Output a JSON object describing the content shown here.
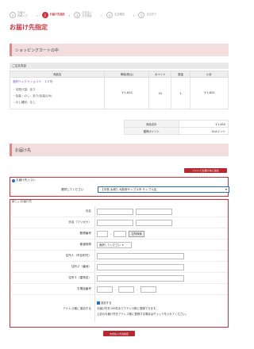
{
  "steps": [
    {
      "num": "1",
      "label": "お届け\n情報入力"
    },
    {
      "num": "2",
      "label": "お届け先指定"
    },
    {
      "num": "3",
      "label": "お支払い\n方法指定"
    },
    {
      "num": "4",
      "label": "注文確認"
    },
    {
      "num": "5",
      "label": "注文完了"
    }
  ],
  "page_title": "お届け先指定",
  "cart_section_title": "ショッピングカートの中",
  "order_details_label": "ご注文内容",
  "cart_headers": [
    "商品名",
    "単価(税込)",
    "ポイント",
    "数量",
    "小計"
  ],
  "cart_item": {
    "name": "酒好ベイクドショコラ　１２号",
    "options": [
      "・手提げ袋：あり",
      "・包装・のし：あり(包装のみ)",
      "・のし種別：なし"
    ],
    "price": "￥1,620",
    "points": "15",
    "qty": "1",
    "subtotal": "￥1,620"
  },
  "totals": [
    {
      "label": "商品合計",
      "value": "￥1,620"
    },
    {
      "label": "獲得ポイント",
      "value": "15ポイント"
    }
  ],
  "address_section_title": "お届け先",
  "add_to_list_button": "いいいでお届け先に追加",
  "address_list": {
    "header": "お届け先リスト",
    "prompt": "選択してください",
    "selected": "【中島 太郎】大阪府サンプル市 サンプル区"
  },
  "new_address_header": "新しいお届け先",
  "form": {
    "name_label": "氏名",
    "kana_label": "氏名（フリガナ）",
    "zip_label": "郵便番号",
    "zip_dash": "-",
    "zip_search_button": "住所検索",
    "pref_label": "都道府県",
    "pref_placeholder": "選択してください",
    "addr1_label": "住所１（市区町村）",
    "addr2_label": "住所２（番地）",
    "addr3_label": "住所３（建物名）",
    "phone_label": "お電話番号",
    "phone_dash": "-",
    "save_label": "アドレス帳に追加する",
    "save_checkbox": "追加する",
    "save_note1": "お届け先を150件までアドレス帳に登録できます。",
    "save_note2": "上記のお届け先をアドレス帳に登録する場合はチェックを入れてください。"
  },
  "submit_button": "お支払い方法指定",
  "colors": {
    "accent": "#c8333b",
    "section_bg": "#f2dede",
    "link": "#7a4cc4"
  }
}
